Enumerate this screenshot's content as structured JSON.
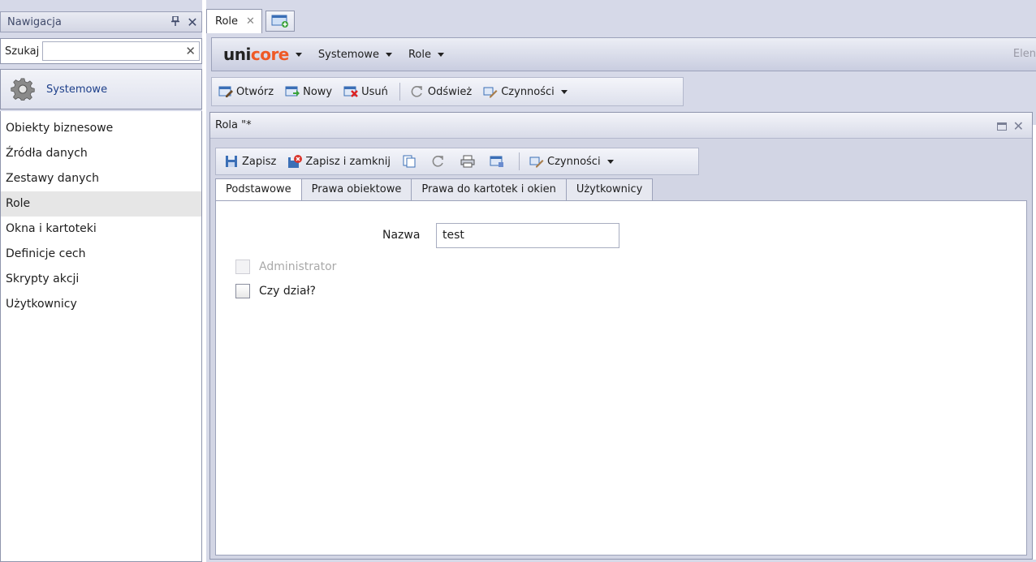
{
  "nav": {
    "title": "Nawigacja",
    "pin_icon": "pin-icon",
    "search_label": "Szukaj",
    "search_value": "",
    "section": {
      "label": "Systemowe",
      "icon": "gear-icon"
    },
    "items": [
      "Obiekty biznesowe",
      "Źródła danych",
      "Zestawy danych",
      "Role",
      "Okna i kartoteki",
      "Definicje cech",
      "Skrypty akcji",
      "Użytkownicy"
    ],
    "selected_item": "Role"
  },
  "doc_tab": {
    "label": "Role"
  },
  "menu": {
    "logo_part1": "uni",
    "logo_part2": "core",
    "items": [
      "Systemowe",
      "Role"
    ],
    "right_text": "Elen"
  },
  "toolbar": {
    "open": "Otwórz",
    "new": "Nowy",
    "delete": "Usuń",
    "refresh": "Odśwież",
    "actions": "Czynności"
  },
  "window": {
    "title": "Rola \"*",
    "toolbar": {
      "save": "Zapisz",
      "save_close": "Zapisz i zamknij",
      "actions": "Czynności"
    },
    "tabs": [
      "Podstawowe",
      "Prawa obiektowe",
      "Prawa do kartotek i okien",
      "Użytkownicy"
    ],
    "active_tab": "Podstawowe",
    "form": {
      "name_label": "Nazwa",
      "name_value": "test",
      "admin_label": "Administrator",
      "admin_checked": false,
      "admin_disabled": true,
      "dept_label": "Czy dział?",
      "dept_checked": false
    }
  },
  "colors": {
    "panel_bg": "#d6d9e8",
    "logo_accent": "#ef5a26",
    "link_blue": "#1d3f8a"
  }
}
